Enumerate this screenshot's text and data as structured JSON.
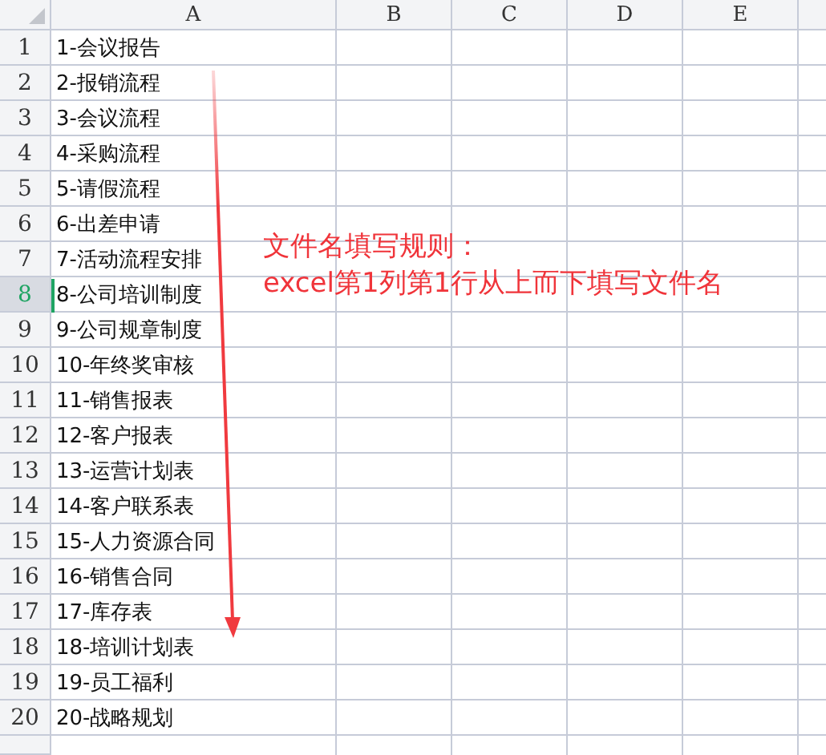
{
  "columns": [
    "A",
    "B",
    "C",
    "D",
    "E"
  ],
  "rows": [
    {
      "number": "1",
      "cell": "1-会议报告",
      "selected": false
    },
    {
      "number": "2",
      "cell": "2-报销流程",
      "selected": false
    },
    {
      "number": "3",
      "cell": "3-会议流程",
      "selected": false
    },
    {
      "number": "4",
      "cell": "4-采购流程",
      "selected": false
    },
    {
      "number": "5",
      "cell": "5-请假流程",
      "selected": false
    },
    {
      "number": "6",
      "cell": "6-出差申请",
      "selected": false
    },
    {
      "number": "7",
      "cell": "7-活动流程安排",
      "selected": false
    },
    {
      "number": "8",
      "cell": "8-公司培训制度",
      "selected": true
    },
    {
      "number": "9",
      "cell": "9-公司规章制度",
      "selected": false
    },
    {
      "number": "10",
      "cell": "10-年终奖审核",
      "selected": false
    },
    {
      "number": "11",
      "cell": "11-销售报表",
      "selected": false
    },
    {
      "number": "12",
      "cell": "12-客户报表",
      "selected": false
    },
    {
      "number": "13",
      "cell": "13-运营计划表",
      "selected": false
    },
    {
      "number": "14",
      "cell": "14-客户联系表",
      "selected": false
    },
    {
      "number": "15",
      "cell": "15-人力资源合同",
      "selected": false
    },
    {
      "number": "16",
      "cell": "16-销售合同",
      "selected": false
    },
    {
      "number": "17",
      "cell": "17-库存表",
      "selected": false
    },
    {
      "number": "18",
      "cell": "18-培训计划表",
      "selected": false
    },
    {
      "number": "19",
      "cell": "19-员工福利",
      "selected": false
    },
    {
      "number": "20",
      "cell": "20-战略规划",
      "selected": false
    }
  ],
  "annotation": {
    "title": "文件名填写规则：",
    "rule": "excel第1列第1行从上而下填写文件名"
  }
}
